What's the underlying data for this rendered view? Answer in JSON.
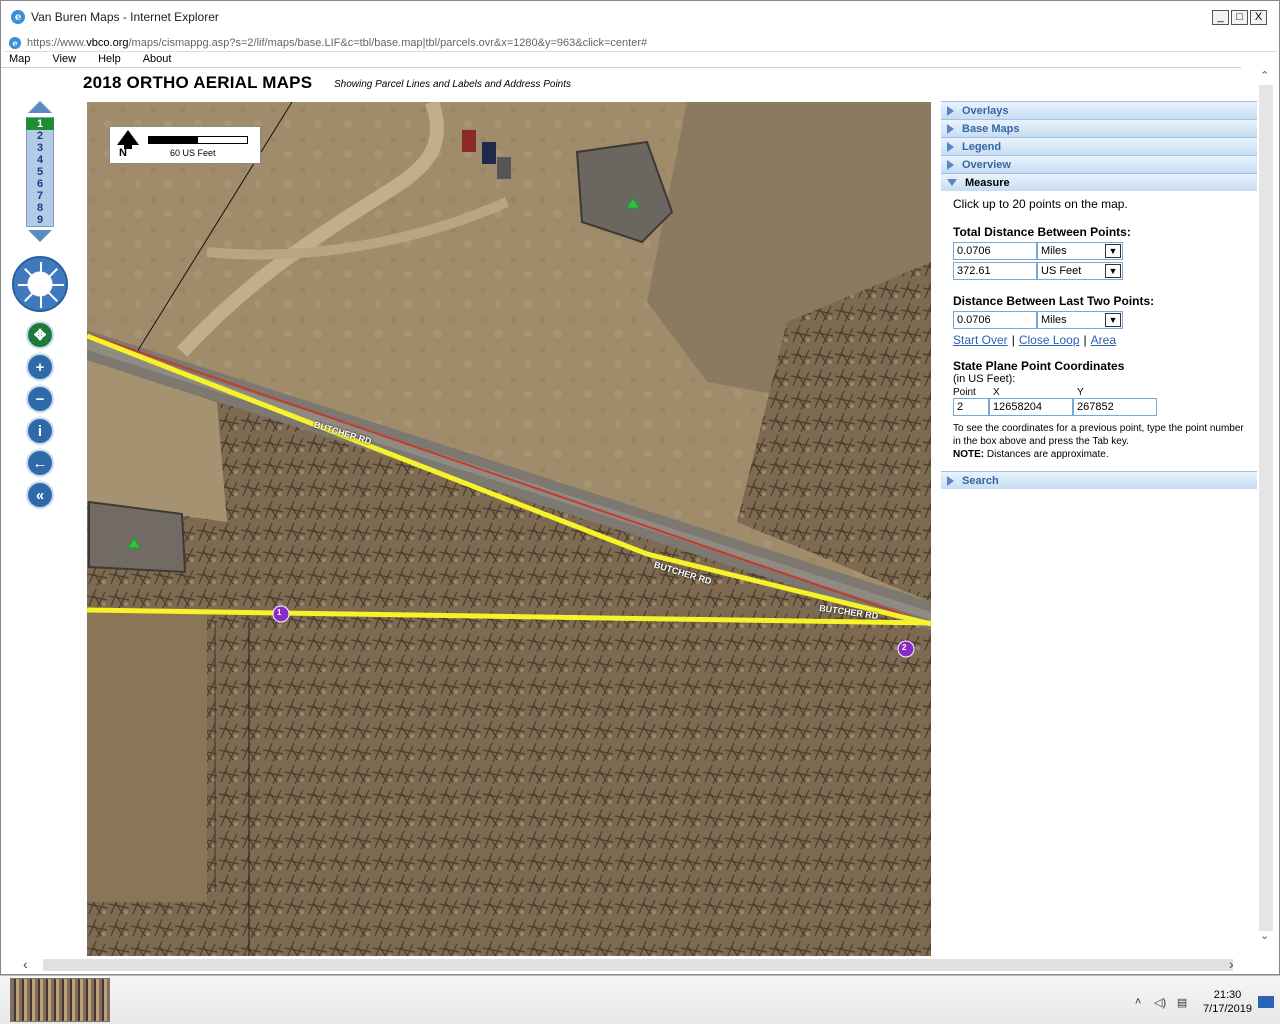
{
  "window": {
    "title": "Van Buren Maps - Internet Explorer",
    "controls": {
      "minimize": "_",
      "maximize": "□",
      "close": "X"
    }
  },
  "address": {
    "prefix": "https://www.",
    "domain": "vbco.org",
    "rest": "/maps/cismappg.asp?s=2/lif/maps/base.LIF&c=tbl/base.map|tbl/parcels.ovr&x=1280&y=963&click=center#"
  },
  "menu": [
    "Map",
    "View",
    "Help",
    "About"
  ],
  "page": {
    "title": "2018 ORTHO AERIAL MAPS",
    "subtitle": "Showing Parcel Lines and Labels and Address Points"
  },
  "zoom": {
    "levels": [
      "1",
      "2",
      "3",
      "4",
      "5",
      "6",
      "7",
      "8",
      "9"
    ],
    "active": "1"
  },
  "map": {
    "scale_label": "60 US Feet",
    "north_label": "N",
    "road_labels": [
      "BUTCHER RD",
      "BUTCHER RD",
      "BUTCHER RD"
    ],
    "points": [
      "1",
      "2"
    ],
    "colors": {
      "measure_line": "#f7f32a",
      "point": "#8a2bc9",
      "address_point": "#3bbd3b"
    }
  },
  "panel": {
    "sections": {
      "overlays": "Overlays",
      "base_maps": "Base Maps",
      "legend": "Legend",
      "overview": "Overview",
      "measure": "Measure",
      "search": "Search"
    },
    "measure": {
      "hint": "Click up to 20 points on the map.",
      "total_label": "Total Distance Between Points:",
      "total_value_1": "0.0706",
      "total_unit_1": "Miles",
      "total_value_2": "372.61",
      "total_unit_2": "US Feet",
      "last_label": "Distance Between Last Two Points:",
      "last_value": "0.0706",
      "last_unit": "Miles",
      "links": {
        "start_over": "Start Over",
        "close_loop": "Close Loop",
        "area": "Area"
      },
      "coords_label": "State Plane Point Coordinates",
      "coords_sub": "(in US Feet):",
      "coords_heads": {
        "point": "Point",
        "x": "X",
        "y": "Y"
      },
      "point_value": "2",
      "x_value": "12658204",
      "y_value": "267852",
      "note_text": "To see the coordinates for a previous point, type the point number in the box above and press the Tab key.",
      "note_bold": "NOTE:",
      "note_rest": "Distances are approximate."
    }
  },
  "taskbar": {
    "time": "21:30",
    "date": "7/17/2019"
  }
}
